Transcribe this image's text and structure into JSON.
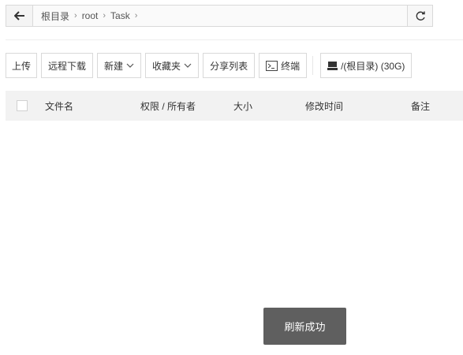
{
  "path": {
    "crumbs": [
      "根目录",
      "root",
      "Task"
    ],
    "separator": "›"
  },
  "toolbar": {
    "upload": "上传",
    "remote_download": "远程下载",
    "new": "新建",
    "favorites": "收藏夹",
    "share_list": "分享列表",
    "terminal": "终端",
    "disk": "/(根目录) (30G)"
  },
  "table": {
    "headers": [
      "文件名",
      "权限 / 所有者",
      "大小",
      "修改时间",
      "备注"
    ]
  },
  "toast": {
    "text": "刷新成功"
  },
  "icons": {
    "back": "arrow-left-icon",
    "refresh": "refresh-icon",
    "terminal": "terminal-icon",
    "disk": "disk-icon",
    "chevron": "chevron-down-icon"
  }
}
